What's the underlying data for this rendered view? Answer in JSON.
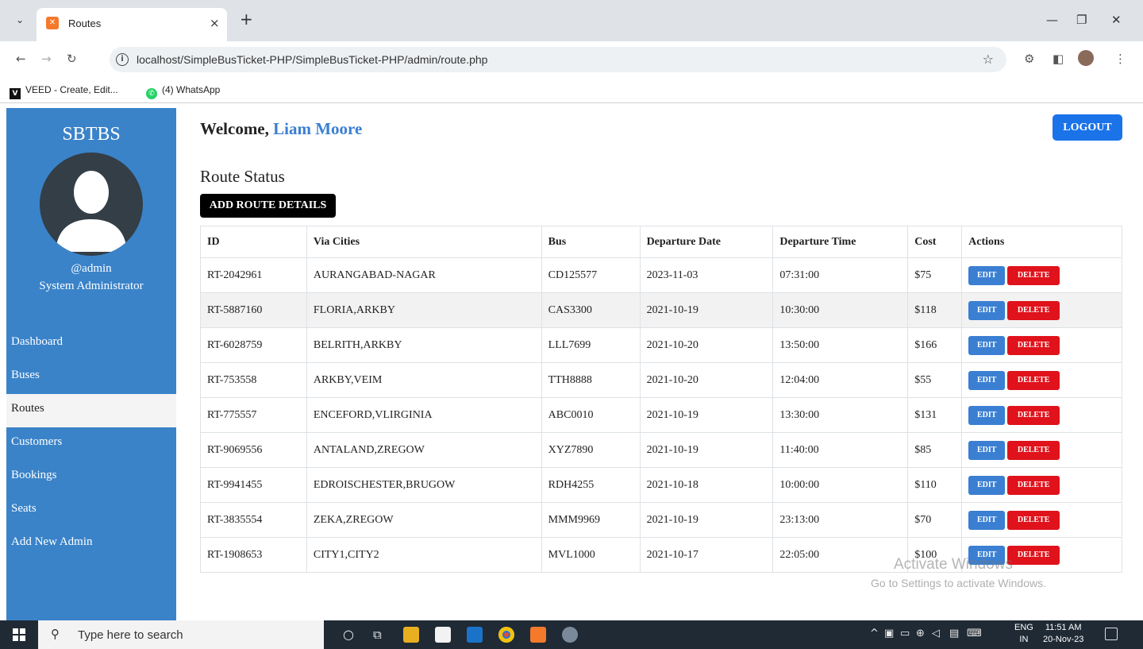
{
  "browser": {
    "tab_title": "Routes",
    "tab_close": "×",
    "new_tab": "+",
    "url": "localhost/SimpleBusTicket-PHP/SimpleBusTicket-PHP/admin/route.php",
    "bookmarks": [
      {
        "label": "VEED - Create, Edit...",
        "icon": "veed-icon",
        "color": "#111111"
      },
      {
        "label": "(4) WhatsApp",
        "icon": "whatsapp-icon",
        "color": "#25d366"
      }
    ]
  },
  "sidebar": {
    "brand": "SBTBS",
    "user_handle": "@admin",
    "user_role": "System Administrator",
    "items": [
      {
        "label": "Dashboard",
        "active": false
      },
      {
        "label": "Buses",
        "active": false
      },
      {
        "label": "Routes",
        "active": true
      },
      {
        "label": "Customers",
        "active": false
      },
      {
        "label": "Bookings",
        "active": false
      },
      {
        "label": "Seats",
        "active": false
      },
      {
        "label": "Add New Admin",
        "active": false
      }
    ],
    "color": "#3a83c9"
  },
  "header": {
    "welcome_prefix": "Welcome, ",
    "username": "Liam Moore",
    "logout_label": "LOGOUT"
  },
  "main": {
    "section_title": "Route Status",
    "add_button_label": "ADD ROUTE DETAILS",
    "table": {
      "columns": [
        "ID",
        "Via Cities",
        "Bus",
        "Departure Date",
        "Departure Time",
        "Cost",
        "Actions"
      ],
      "edit_label": "EDIT",
      "delete_label": "DELETE",
      "rows": [
        [
          "RT-2042961",
          "AURANGABAD-NAGAR",
          "CD125577",
          "2023-11-03",
          "07:31:00",
          "$75"
        ],
        [
          "RT-5887160",
          "FLORIA,ARKBY",
          "CAS3300",
          "2021-10-19",
          "10:30:00",
          "$118"
        ],
        [
          "RT-6028759",
          "BELRITH,ARKBY",
          "LLL7699",
          "2021-10-20",
          "13:50:00",
          "$166"
        ],
        [
          "RT-753558",
          "ARKBY,VEIM",
          "TTH8888",
          "2021-10-20",
          "12:04:00",
          "$55"
        ],
        [
          "RT-775557",
          "ENCEFORD,VLIRGINIA",
          "ABC0010",
          "2021-10-19",
          "13:30:00",
          "$131"
        ],
        [
          "RT-9069556",
          "ANTALAND,ZREGOW",
          "XYZ7890",
          "2021-10-19",
          "11:40:00",
          "$85"
        ],
        [
          "RT-9941455",
          "EDROISCHESTER,BRUGOW",
          "RDH4255",
          "2021-10-18",
          "10:00:00",
          "$110"
        ],
        [
          "RT-3835554",
          "ZEKA,ZREGOW",
          "MMM9969",
          "2021-10-19",
          "23:13:00",
          "$70"
        ],
        [
          "RT-1908653",
          "CITY1,CITY2",
          "MVL1000",
          "2021-10-17",
          "22:05:00",
          "$100"
        ]
      ]
    }
  },
  "watermark": {
    "line1": "Activate Windows",
    "line2": "Go to Settings to activate Windows."
  },
  "taskbar": {
    "search_placeholder": "Type here to search",
    "lang_line1": "ENG",
    "lang_line2": "IN",
    "time": "11:51 AM",
    "date": "20-Nov-23"
  }
}
